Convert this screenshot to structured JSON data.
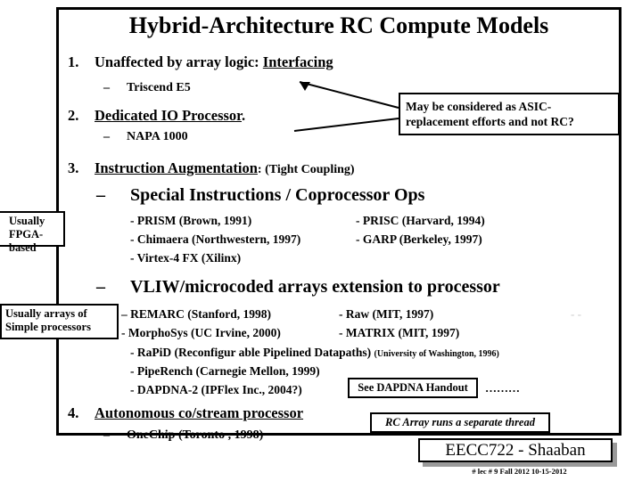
{
  "slide": {
    "title": "Hybrid-Architecture RC Compute Models",
    "items": [
      {
        "num": "1.",
        "text_plain": "Unaffected by array logic:  ",
        "text_underlined": "Interfacing"
      },
      {
        "num": "2.",
        "text_underlined": "Dedicated IO Processor",
        "text_trailing": "."
      },
      {
        "num": "3.",
        "text_underlined": "Instruction Augmentation",
        "text_trailing": ": (Tight Coupling)"
      },
      {
        "num": "4.",
        "text_underlined": "Autonomous co/stream processor",
        "text_trailing": ""
      }
    ],
    "sub_items": [
      {
        "dash": "–",
        "text": "Triscend E5"
      },
      {
        "dash": "–",
        "text": "NAPA 1000"
      },
      {
        "dash": "–",
        "text": "OneChip (Toronto , 1998)"
      }
    ],
    "headings": [
      {
        "dash": "–",
        "text": "Special Instructions / Coprocessor Ops"
      },
      {
        "dash": "–",
        "text": "VLIW/microcoded arrays extension to processor"
      }
    ],
    "refs_special_left": [
      "- PRISM  (Brown, 1991)",
      "- Chimaera (Northwestern, 1997)",
      "- Virtex-4 FX (Xilinx)"
    ],
    "refs_special_right": [
      "- PRISC (Harvard, 1994)",
      "- GARP (Berkeley, 1997)"
    ],
    "refs_vliw_left": [
      "–  REMARC (Stanford, 1998)",
      "-  MorphoSys (UC Irvine, 2000)"
    ],
    "refs_vliw_right": [
      "-   Raw (MIT, 1997)",
      "-   MATRIX (MIT, 1997)"
    ],
    "refs_vliw_wide": [
      {
        "main": "-  RaPiD (Reconfigur able Pipelined Datapaths) ",
        "small": "(University of Washington, 1996)"
      },
      {
        "main": "-  PipeRench (Carnegie Mellon, 1999)",
        "small": ""
      },
      {
        "main": "-  DAPDNA-2 (IPFlex Inc., 2004?)",
        "small": ""
      }
    ],
    "notes": {
      "fpga_box_line1": "Usually",
      "fpga_box_line2": "FPGA-based",
      "arrays_box_line1": "Usually arrays of",
      "arrays_box_line2": "Simple processors",
      "callout_line1": "May be considered as ASIC-",
      "callout_line2": "replacement efforts and not RC?",
      "handout": "See DAPDNA Handout",
      "dots": "………",
      "thread_note": "RC Array runs a separate thread",
      "right_artifact": "- -"
    },
    "footer": {
      "course": "EECC722 - Shaaban",
      "meta": "#  lec # 9    Fall 2012   10-15-2012"
    }
  }
}
